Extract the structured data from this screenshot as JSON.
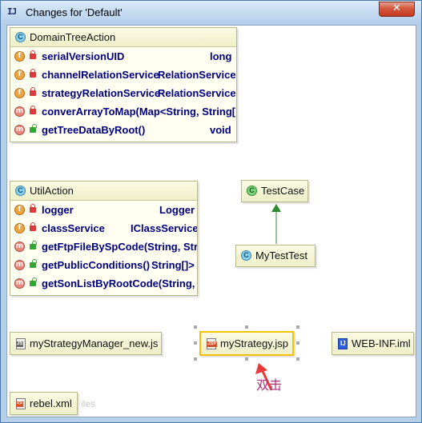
{
  "window": {
    "title": "Changes for 'Default'",
    "close_label": "✕",
    "app_icon_label": "IJ"
  },
  "classes": {
    "domain_tree_action": {
      "name": "DomainTreeAction",
      "badge": "C",
      "members": [
        {
          "badge": "f",
          "access": "private",
          "name": "serialVersionUID",
          "type": "long"
        },
        {
          "badge": "f",
          "access": "private",
          "name": "channelRelationService",
          "type": "RelationService"
        },
        {
          "badge": "f",
          "access": "private",
          "name": "strategyRelationService",
          "type": "RelationService"
        },
        {
          "badge": "m",
          "access": "private",
          "name": "converArrayToMap(Map<String, String[",
          "type": ""
        },
        {
          "badge": "m",
          "access": "public",
          "name": "getTreeDataByRoot()",
          "type": "void"
        }
      ]
    },
    "util_action": {
      "name": "UtilAction",
      "badge": "C",
      "members": [
        {
          "badge": "f",
          "access": "private",
          "name": "logger",
          "type": "Logger"
        },
        {
          "badge": "f",
          "access": "private",
          "name": "classService",
          "type": "IClassService"
        },
        {
          "badge": "m",
          "access": "public",
          "name": "getFtpFileBySpCode(String, Stri",
          "type": ""
        },
        {
          "badge": "m",
          "access": "public",
          "name": "getPublicConditions()",
          "type": "String[]>"
        },
        {
          "badge": "m",
          "access": "public",
          "name": "getSonListByRootCode(String, H",
          "type": ""
        }
      ]
    },
    "test_case": {
      "name": "TestCase",
      "badge": "C"
    },
    "my_test_test": {
      "name": "MyTestTest",
      "badge": "C"
    }
  },
  "files": {
    "strategy_manager_js": {
      "name": "myStrategyManager_new.js",
      "icon_text": "JS"
    },
    "strategy_jsp": {
      "name": "myStrategy.jsp",
      "icon_text": "JSP"
    },
    "web_inf_iml": {
      "name": "WEB-INF.iml",
      "icon_text": "IJ"
    },
    "rebel_xml": {
      "name": "rebel.xml",
      "icon_text": "<>"
    }
  },
  "faint_text": "iles",
  "annotation": {
    "text": "双击",
    "color": "#e83a3a"
  },
  "colors": {
    "inheritance_arrow": "#2e8a2e",
    "selection_border": "#f3c200",
    "member_text": "#000080"
  }
}
